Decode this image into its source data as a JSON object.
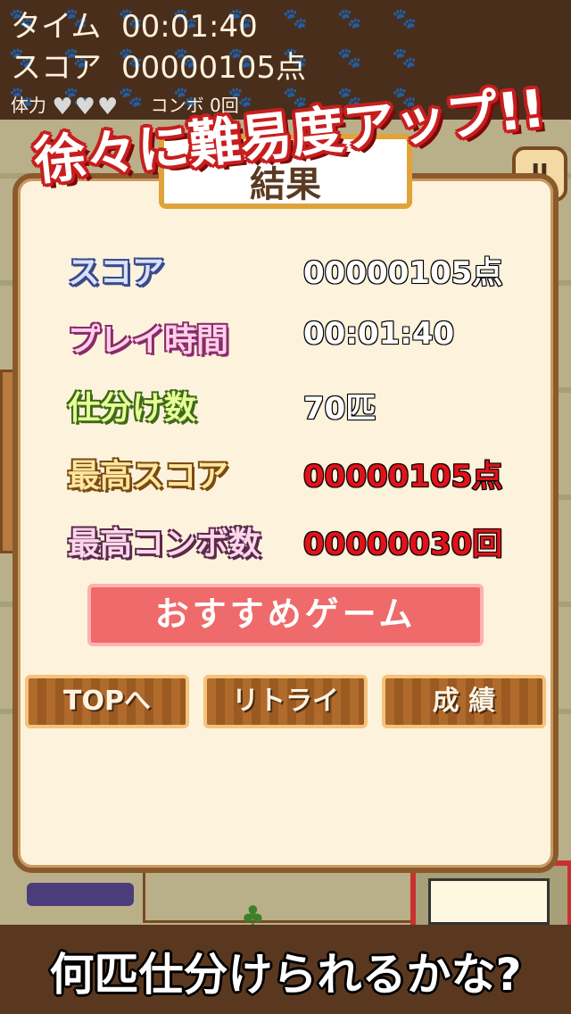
{
  "hud": {
    "time_label": "タイム",
    "time_value": "00:01:40",
    "score_label": "スコア",
    "score_value": "00000105点",
    "life_label": "体力",
    "combo_text": "コンボ 0回"
  },
  "banner": "徐々に難易度アップ!!",
  "dialog": {
    "title": "結果",
    "rows": [
      {
        "label": "スコア",
        "value": "00000105点"
      },
      {
        "label": "プレイ時間",
        "value": "00:01:40"
      },
      {
        "label": "仕分け数",
        "value": "70匹"
      },
      {
        "label": "最高スコア",
        "value": "00000105点"
      },
      {
        "label": "最高コンボ数",
        "value": "00000030回"
      }
    ],
    "recommend_button": "おすすめゲーム",
    "top_button": "TOPへ",
    "retry_button": "リトライ",
    "record_button": "成 績"
  },
  "footer": "何匹仕分けられるかな?"
}
